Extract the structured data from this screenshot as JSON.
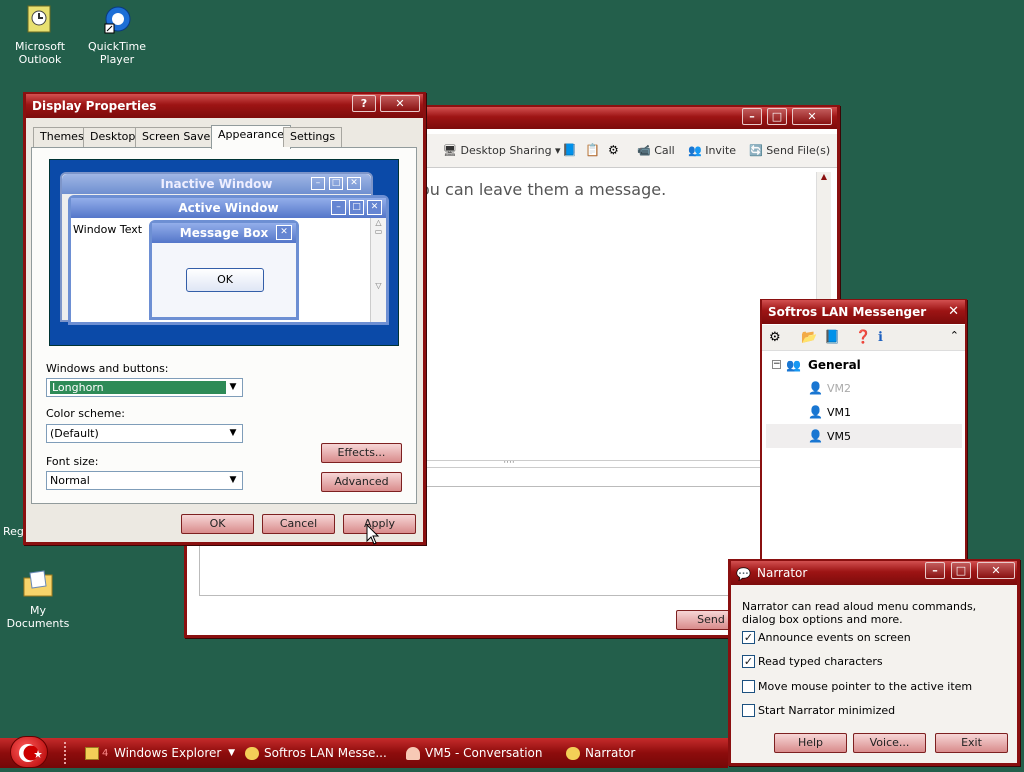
{
  "desktop": {
    "icons": [
      {
        "label": "Microsoft Outlook"
      },
      {
        "label": "QuickTime Player"
      },
      {
        "label": "My Documents"
      }
    ],
    "partial_labels": {
      "reg": "Reg"
    }
  },
  "display_properties": {
    "title": "Display Properties",
    "tabs": [
      "Themes",
      "Desktop",
      "Screen Saver",
      "Appearance",
      "Settings"
    ],
    "preview": {
      "inactive_title": "Inactive Window",
      "active_title": "Active Window",
      "window_text": "Window Text",
      "message_box_title": "Message Box",
      "ok_label": "OK"
    },
    "windows_buttons_label": "Windows and buttons:",
    "windows_buttons_value": "Longhorn",
    "color_scheme_label": "Color scheme:",
    "color_scheme_value": "(Default)",
    "font_size_label": "Font size:",
    "font_size_value": "Normal",
    "effects_label": "Effects...",
    "advanced_label": "Advanced",
    "ok_label": "OK",
    "cancel_label": "Cancel",
    "apply_label": "Apply"
  },
  "conversation": {
    "toolbar": {
      "desktop_sharing": "Desktop Sharing",
      "call": "Call",
      "invite": "Invite",
      "send_files": "Send File(s)"
    },
    "message_text": "ou can leave them a message.",
    "send_label": "Send"
  },
  "messenger": {
    "title": "Softros LAN Messenger",
    "group": "General",
    "contacts": [
      "VM2",
      "VM1",
      "VM5"
    ]
  },
  "narrator": {
    "title": "Narrator",
    "description": "Narrator can read aloud menu commands, dialog box options and more.",
    "options": [
      {
        "label": "Announce events on screen",
        "checked": true
      },
      {
        "label": "Read typed characters",
        "checked": true
      },
      {
        "label": "Move mouse pointer to the active item",
        "checked": false
      },
      {
        "label": "Start Narrator minimized",
        "checked": false
      }
    ],
    "help_label": "Help",
    "voice_label": "Voice...",
    "exit_label": "Exit"
  },
  "taskbar": {
    "items": [
      {
        "label": "Windows Explorer",
        "count": "4"
      },
      {
        "label": "Softros LAN Messe..."
      },
      {
        "label": "VM5 - Conversation"
      },
      {
        "label": "Narrator"
      }
    ]
  },
  "colors": {
    "accent": "#9d1414",
    "desktop": "#235f4b",
    "selection": "#2e8b57"
  }
}
